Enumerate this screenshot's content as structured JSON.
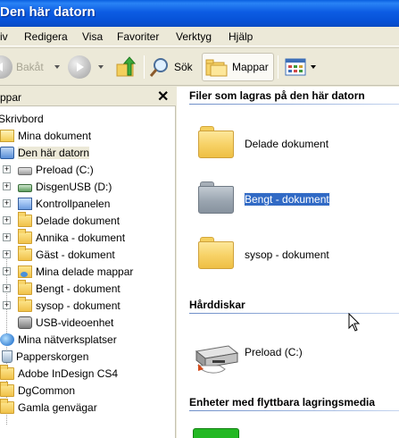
{
  "window": {
    "title": "Den här datorn"
  },
  "menu": [
    "iv",
    "Redigera",
    "Visa",
    "Favoriter",
    "Verktyg",
    "Hjälp"
  ],
  "toolbar": {
    "back_label": "Bakåt",
    "search_label": "Sök",
    "folders_label": "Mappar"
  },
  "leftpane": {
    "title": "ppar",
    "close": "✕",
    "items": [
      {
        "label": "Skrivbord",
        "icon": "desktop-icon"
      },
      {
        "label": "Mina dokument",
        "icon": "my-documents-icon"
      },
      {
        "label": "Den här datorn",
        "icon": "my-computer-icon",
        "selected": true
      },
      {
        "label": "Preload (C:)",
        "icon": "drive-icon",
        "expander": "+"
      },
      {
        "label": "DisgenUSB (D:)",
        "icon": "usb-drive-icon",
        "expander": "+"
      },
      {
        "label": "Kontrollpanelen",
        "icon": "control-panel-icon",
        "expander": "+"
      },
      {
        "label": "Delade dokument",
        "icon": "folder-icon",
        "expander": "+"
      },
      {
        "label": "Annika - dokument",
        "icon": "folder-icon",
        "expander": "+"
      },
      {
        "label": "Gäst - dokument",
        "icon": "folder-icon",
        "expander": "+"
      },
      {
        "label": "Mina delade mappar",
        "icon": "shared-folder-icon",
        "expander": "+"
      },
      {
        "label": "Bengt - dokument",
        "icon": "folder-icon",
        "expander": "+"
      },
      {
        "label": "sysop - dokument",
        "icon": "folder-icon",
        "expander": "+"
      },
      {
        "label": "USB-videoenhet",
        "icon": "camera-icon"
      },
      {
        "label": "Mina nätverksplatser",
        "icon": "network-icon",
        "expander": "+"
      },
      {
        "label": "Papperskorgen",
        "icon": "recycle-bin-icon"
      },
      {
        "label": "Adobe InDesign CS4",
        "icon": "folder-icon"
      },
      {
        "label": "DgCommon",
        "icon": "folder-icon"
      },
      {
        "label": "Gamla genvägar",
        "icon": "folder-icon"
      }
    ]
  },
  "rightpane": {
    "group1": "Filer som lagras på den här datorn",
    "folders": [
      {
        "label": "Delade dokument",
        "color": "yellow"
      },
      {
        "label": "Bengt - dokument",
        "color": "gray",
        "selected": true
      },
      {
        "label": "sysop - dokument",
        "color": "yellow"
      }
    ],
    "group2": "Hårddiskar",
    "drives": [
      {
        "label": "Preload (C:)"
      }
    ],
    "group3": "Enheter med flyttbara lagringsmedia"
  },
  "colors": {
    "titlebar": "#0c5ce3",
    "selection": "#316ac5",
    "chrome": "#ece9d8"
  }
}
